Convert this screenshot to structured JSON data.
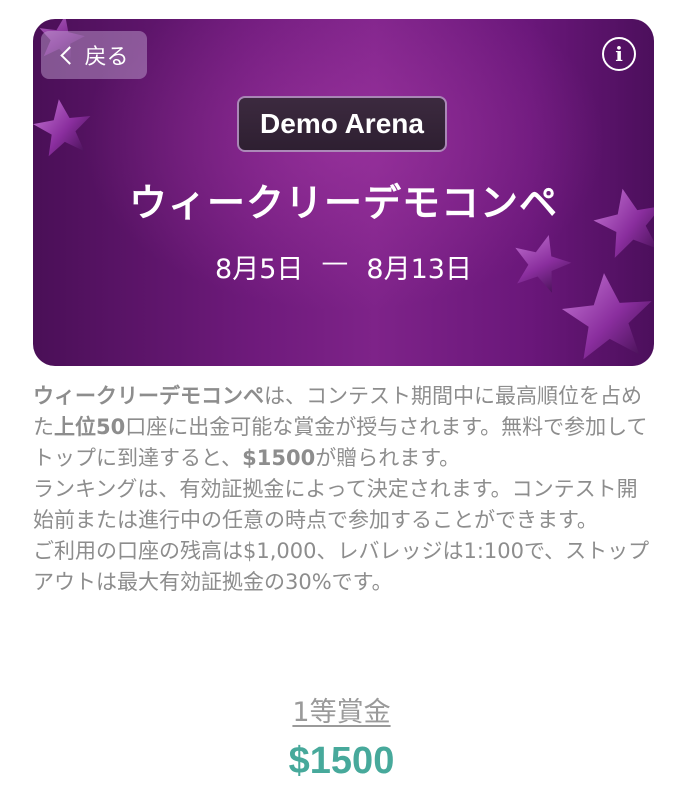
{
  "header": {
    "back_label": "戻る",
    "info_glyph": "i",
    "badge": "Demo Arena",
    "title": "ウィークリーデモコンペ",
    "date_start": "8月5日",
    "date_sep": "—",
    "date_end": "8月13日"
  },
  "description": {
    "p1_bold_1": "ウィークリーデモコンペ",
    "p1_text_1": "は、コンテスト期間中に最高順位を占めた",
    "p1_bold_2": "上位50",
    "p1_text_2": "口座に出金可能な賞金が授与されます。無料で参加してトップに到達すると、",
    "p1_bold_3": "$1500",
    "p1_text_3": "が贈られます。",
    "p2": "ランキングは、有効証拠金によって決定されます。コンテスト開始前または進行中の任意の時点で参加することができます。",
    "p3": "ご利用の口座の残高は$1,000、レバレッジは1:100で、ストップアウトは最大有効証拠金の30%です。"
  },
  "prize": {
    "label": "1等賞金",
    "value": "$1500"
  },
  "colors": {
    "banner_purple": "#6e1a7b",
    "prize_teal": "#47a99b",
    "text_gray": "#8d8d8d"
  },
  "icons": [
    "chevron-left-icon",
    "info-icon",
    "star-icon"
  ]
}
